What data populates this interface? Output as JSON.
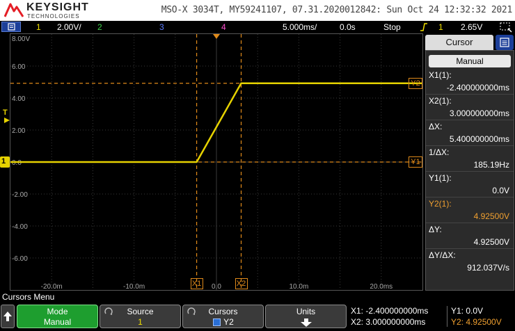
{
  "header": {
    "brand": "KEYSIGHT",
    "brand_sub": "TECHNOLOGIES",
    "device_info": "MSO-X 3034T, MY59241107, 07.31.2020012842: Sun Oct 24 12:32:32 2021"
  },
  "status": {
    "ch1_num": "1",
    "ch1_scale": "2.00V/",
    "ch2_num": "2",
    "ch3_num": "3",
    "ch4_num": "4",
    "timebase": "5.000ms/",
    "delay": "0.0s",
    "run_state": "Stop",
    "trig_ch": "1",
    "trig_level": "2.65V"
  },
  "plot": {
    "y_ticks": [
      "8.00V",
      "6.00",
      "4.00",
      "2.00",
      "0.0",
      "-2.00",
      "-4.00",
      "-6.00"
    ],
    "x_ticks": [
      "-20.0m",
      "-10.0m",
      "0.0",
      "10.0m",
      "20.0ms"
    ],
    "markers": {
      "x1": "X1",
      "x2": "X2",
      "y1": "Y1",
      "y2": "Y2",
      "gnd": "1",
      "trig": "T"
    }
  },
  "chart_data": {
    "type": "line",
    "series": [
      {
        "x": [
          -25,
          -2.4,
          3.0,
          25
        ],
        "y": [
          0,
          0,
          4.925,
          4.925
        ]
      }
    ],
    "xlim": [
      -25,
      25
    ],
    "ylim": [
      -8,
      8
    ],
    "cursor_x1": -2.4,
    "cursor_x2": 3.0,
    "cursor_y1": 0.0,
    "cursor_y2": 4.925,
    "trace_color": "#e6d200",
    "cursor_color": "#e08a1a",
    "grid": true
  },
  "side": {
    "tab": "Cursor",
    "mode": "Manual",
    "x1_label": "X1(1):",
    "x1_value": "-2.400000000ms",
    "x2_label": "X2(1):",
    "x2_value": "3.000000000ms",
    "dx_label": "ΔX:",
    "dx_value": "5.400000000ms",
    "inv_dx_label": "1/ΔX:",
    "inv_dx_value": "185.19Hz",
    "y1_label": "Y1(1):",
    "y1_value": "0.0V",
    "y2_label": "Y2(1):",
    "y2_value": "4.92500V",
    "dy_label": "ΔY:",
    "dy_value": "4.92500V",
    "dydx_label": "ΔY/ΔX:",
    "dydx_value": "912.037V/s"
  },
  "softkeys": {
    "menu_title": "Cursors Menu",
    "mode_title": "Mode",
    "mode_value": "Manual",
    "source_title": "Source",
    "source_value": "1",
    "cursors_title": "Cursors",
    "cursors_value": "Y2",
    "units_title": "Units"
  },
  "readout": {
    "x1": "X1: -2.400000000ms",
    "x2": "X2: 3.000000000ms",
    "y1": "Y1: 0.0V",
    "y2": "Y2: 4.92500V"
  }
}
